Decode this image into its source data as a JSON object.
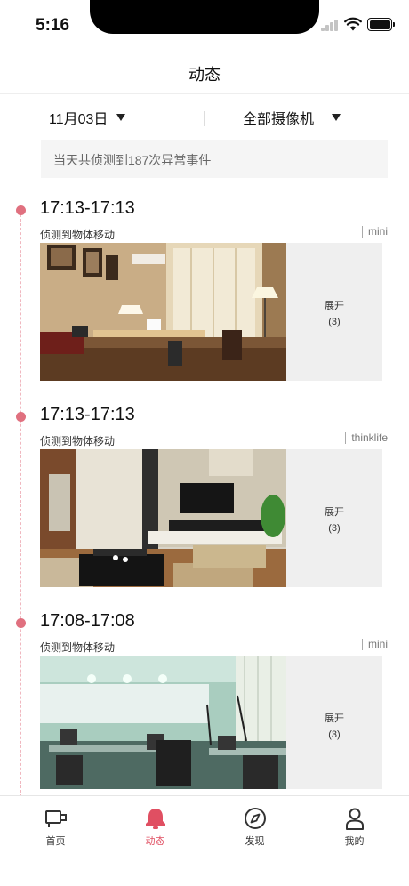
{
  "status_bar": {
    "time": "5:16"
  },
  "nav": {
    "title": "动态"
  },
  "filters": {
    "date": "11月03日",
    "camera": "全部摄像机"
  },
  "summary": "当天共侦测到187次异常事件",
  "events": [
    {
      "time": "17:13-17:13",
      "type": "侦测到物体移动",
      "camera": "mini",
      "expand_label": "展开",
      "count": "(3)"
    },
    {
      "time": "17:13-17:13",
      "type": "侦测到物体移动",
      "camera": "thinklife",
      "expand_label": "展开",
      "count": "(3)"
    },
    {
      "time": "17:08-17:08",
      "type": "侦测到物体移动",
      "camera": "mini",
      "expand_label": "展开",
      "count": "(3)"
    }
  ],
  "tabs": [
    {
      "label": "首页",
      "icon": "camera-icon",
      "active": false
    },
    {
      "label": "动态",
      "icon": "bell-icon",
      "active": true
    },
    {
      "label": "发现",
      "icon": "compass-icon",
      "active": false
    },
    {
      "label": "我的",
      "icon": "person-icon",
      "active": false
    }
  ],
  "colors": {
    "accent": "#e04f62",
    "timeline_dot": "#e0707f",
    "expand_bg": "#efefef"
  }
}
